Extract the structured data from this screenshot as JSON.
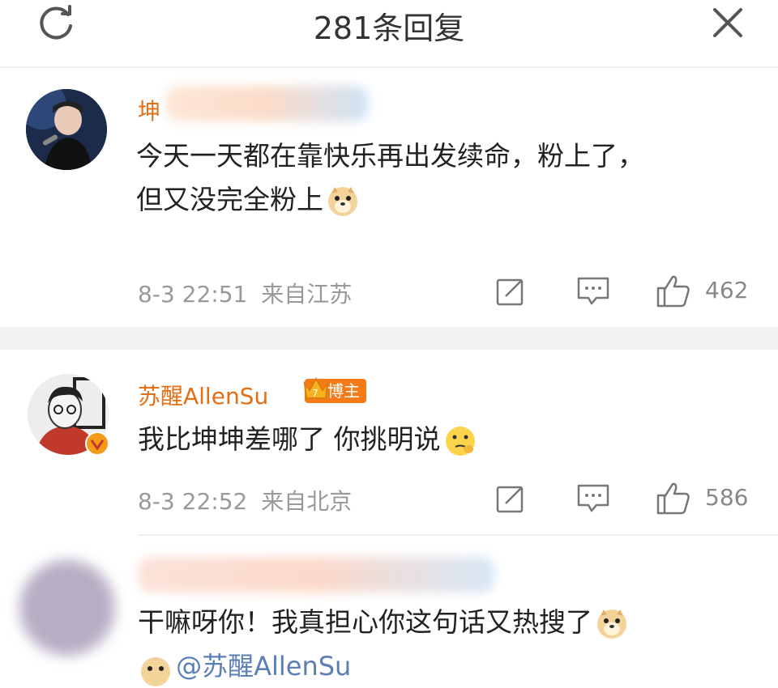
{
  "header": {
    "title": "281条回复",
    "refresh_icon": "refresh-icon",
    "close_icon": "close-icon"
  },
  "comments": [
    {
      "name": "坤",
      "text_line1": "今天一天都在靠快乐再出发续命，粉上了，",
      "text_line2": "但又没完全粉上",
      "time": "8-3 22:51",
      "location": "来自江苏",
      "likes": "462"
    },
    {
      "name": "苏醒AllenSu",
      "badge": "博主",
      "badge_level": "7",
      "text_line1": "我比坤坤差哪了 你挑明说",
      "time": "8-3 22:52",
      "location": "来自北京",
      "likes": "586"
    },
    {
      "name": "",
      "text_line1": "干嘛呀你！我真担心你这句话又热搜了",
      "mention": "@苏醒AllenSu"
    }
  ],
  "colors": {
    "name": "#e36e13",
    "meta": "#999999",
    "separator": "#f2f2f2"
  }
}
